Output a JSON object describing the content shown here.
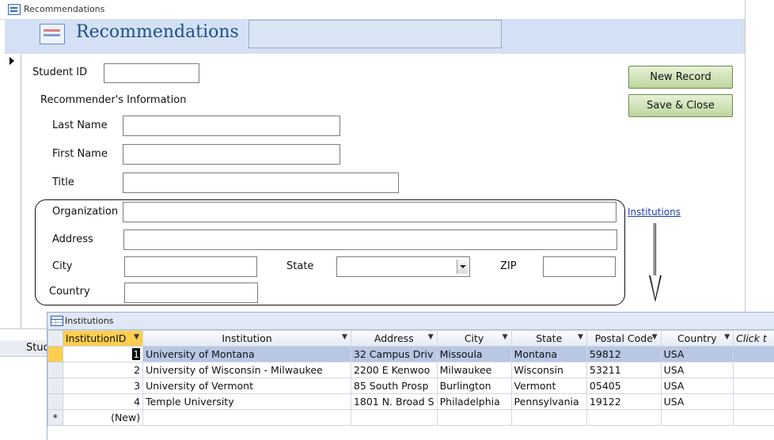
{
  "form": {
    "window_title": "Recommendations",
    "title": "Recommendations",
    "labels": {
      "student_id": "Student ID",
      "section": "Recommender's Information",
      "last_name": "Last Name",
      "first_name": "First Name",
      "title": "Title",
      "organization": "Organization",
      "address": "Address",
      "city": "City",
      "state": "State",
      "zip": "ZIP",
      "country": "Country"
    },
    "buttons": {
      "new_record": "New Record",
      "save_close": "Save & Close"
    },
    "institutions_link": "Institutions"
  },
  "background_subform": {
    "header_text": "Stuc"
  },
  "institutions": {
    "window_title": "Institutions",
    "columns": [
      "InstitutionID",
      "Institution",
      "Address",
      "City",
      "State",
      "Postal Code",
      "Country",
      "Click t"
    ],
    "rows": [
      {
        "id": "1",
        "institution": "University of Montana",
        "address": "32 Campus Driv",
        "city": "Missoula",
        "state": "Montana",
        "postal": "59812",
        "country": "USA"
      },
      {
        "id": "2",
        "institution": "University of Wisconsin - Milwaukee",
        "address": "2200 E Kenwoo",
        "city": "Milwaukee",
        "state": "Wisconsin",
        "postal": "53211",
        "country": "USA"
      },
      {
        "id": "3",
        "institution": "University of Vermont",
        "address": "85 South Prosp",
        "city": "Burlington",
        "state": "Vermont",
        "postal": "05405",
        "country": "USA"
      },
      {
        "id": "4",
        "institution": "Temple University",
        "address": "1801 N. Broad S",
        "city": "Philadelphia",
        "state": "Pennsylvania",
        "postal": "19122",
        "country": "USA"
      }
    ],
    "new_row_label": "(New)",
    "new_row_marker": "*"
  },
  "colors": {
    "header_band": "#d4e1f4",
    "title_text": "#1f4e8c",
    "button_green": "#bdd69e",
    "selected_header": "#ffce4f",
    "current_row": "#b8c7e3",
    "link": "#1c3fb5"
  }
}
